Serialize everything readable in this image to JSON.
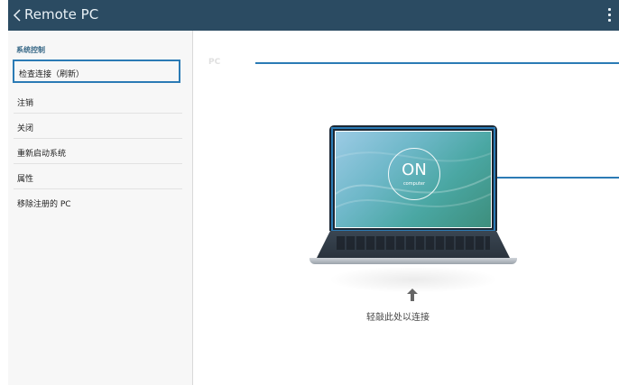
{
  "actionbar": {
    "title": "Remote PC",
    "back_icon": "chevron-left-icon",
    "overflow_icon": "more-vertical-icon",
    "bg_color": "#2b4b62"
  },
  "sidebar": {
    "section_header": "系统控制",
    "items": [
      {
        "label": "检查连接（刷新）",
        "highlighted": true
      },
      {
        "label": "注销"
      },
      {
        "label": "关闭"
      },
      {
        "label": "重新启动系统"
      },
      {
        "label": "属性"
      },
      {
        "label": "移除注册的 PC"
      }
    ]
  },
  "main": {
    "pc_label": "PC",
    "screen": {
      "on_text": "ON",
      "on_subtext": "computer"
    },
    "hint_icon": "arrow-up-icon",
    "tap_hint": "轻敲此处以连接"
  },
  "accent_color": "#2b7bb5"
}
